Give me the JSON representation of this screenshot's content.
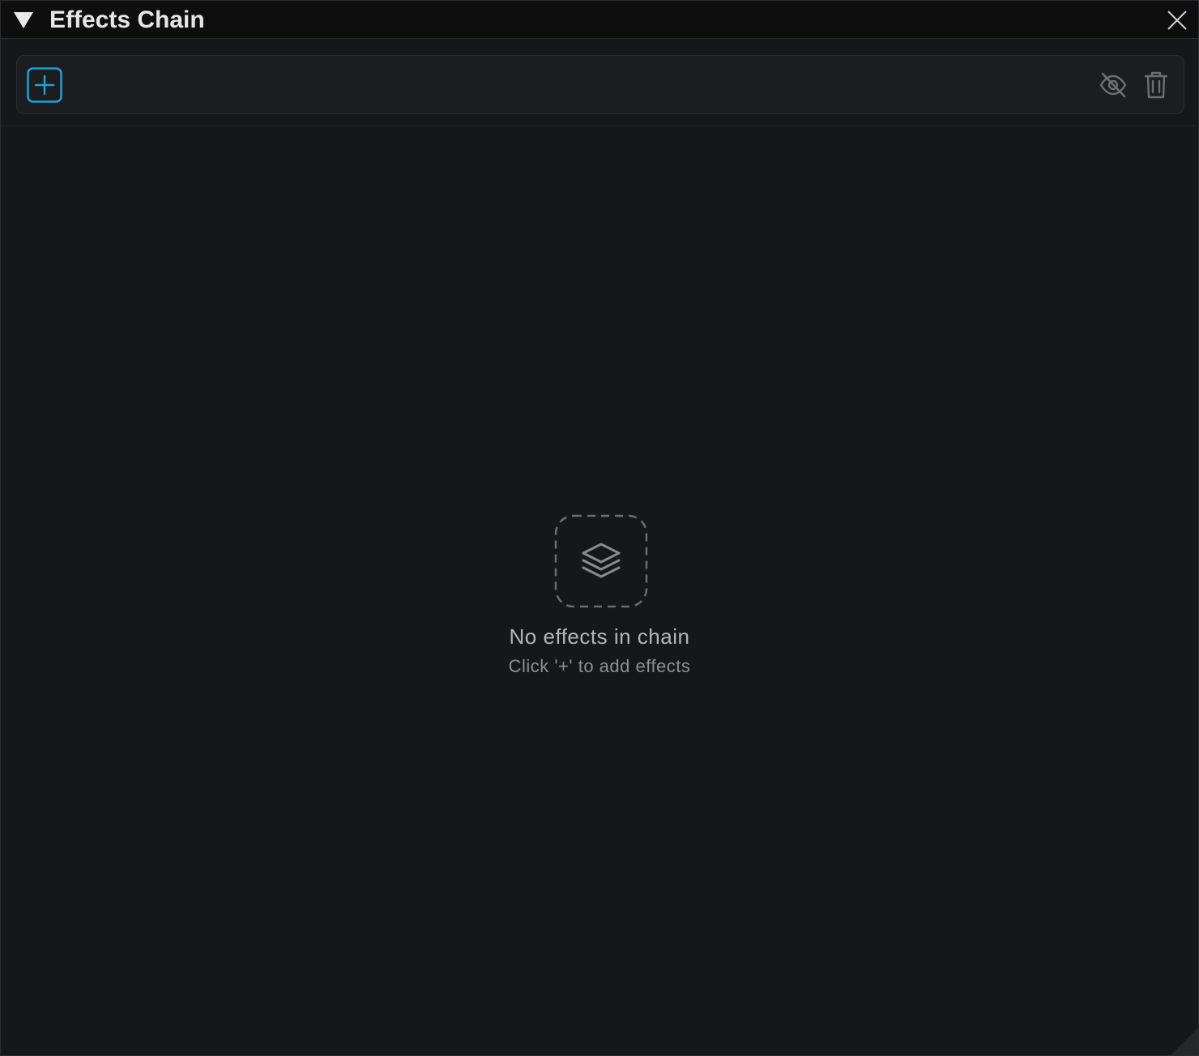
{
  "window": {
    "title": "Effects Chain",
    "collapse_icon": "triangle-down-icon",
    "close_icon": "close-icon"
  },
  "toolbar": {
    "add_icon": "plus-square-icon",
    "hide_icon": "eye-off-icon",
    "delete_icon": "trash-icon",
    "accent_color": "#1aa3d9"
  },
  "empty_state": {
    "icon": "layers-icon",
    "title": "No effects in chain",
    "subtitle": "Click '+' to add effects"
  }
}
